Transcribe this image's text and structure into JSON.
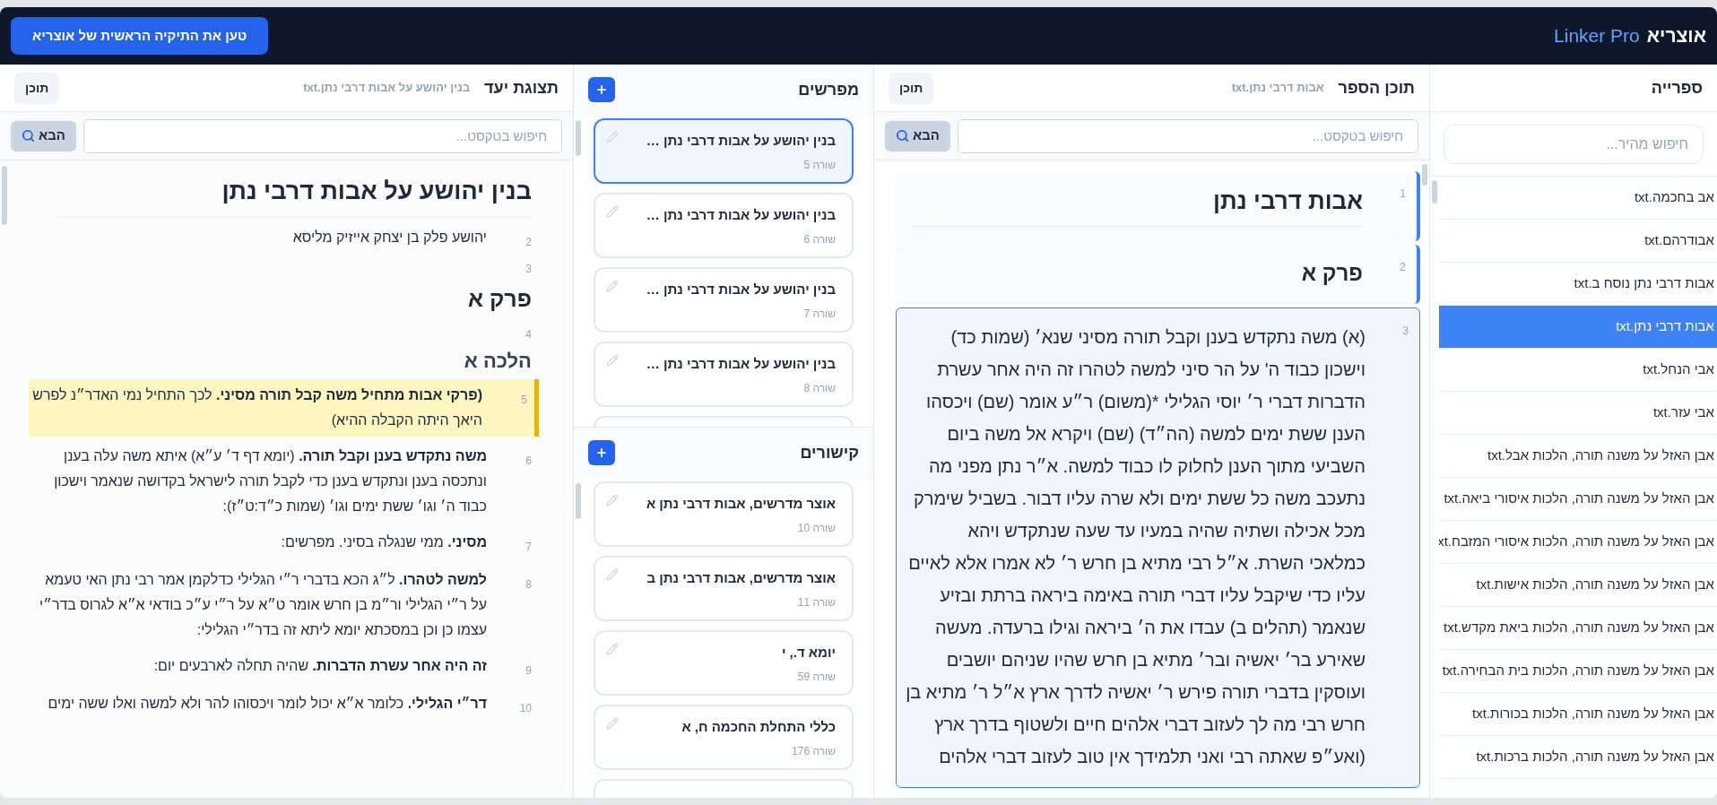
{
  "header": {
    "brand": "אוצריא",
    "product": "Linker Pro",
    "load_button": "טען את התיקיה הראשית של אוצריא"
  },
  "library": {
    "title": "ספרייה",
    "search": {
      "placeholder": "חיפוש מהיר..."
    },
    "items": [
      {
        "label": "אב בחכמה.txt",
        "selected": false
      },
      {
        "label": "אבודרהם.txt",
        "selected": false
      },
      {
        "label": "אבות דרבי נתן נוסח ב.txt",
        "selected": false
      },
      {
        "label": "אבות דרבי נתן.txt",
        "selected": true
      },
      {
        "label": "אבי הנחל.txt",
        "selected": false
      },
      {
        "label": "אבי עזר.txt",
        "selected": false
      },
      {
        "label": "אבן האזל על משנה תורה, הלכות אבל.txt",
        "selected": false
      },
      {
        "label": "אבן האזל על משנה תורה, הלכות איסורי ביאה.txt",
        "selected": false
      },
      {
        "label": "אבן האזל על משנה תורה, הלכות איסורי המזבח.xt",
        "selected": false
      },
      {
        "label": "אבן האזל על משנה תורה, הלכות אישות.txt",
        "selected": false
      },
      {
        "label": "אבן האזל על משנה תורה, הלכות ביאת מקדש.txt",
        "selected": false
      },
      {
        "label": "אבן האזל על משנה תורה, הלכות בית הבחירה.txt",
        "selected": false
      },
      {
        "label": "אבן האזל על משנה תורה, הלכות בכורות.txt",
        "selected": false
      },
      {
        "label": "אבן האזל על משנה תורה, הלכות ברכות.txt",
        "selected": false
      }
    ]
  },
  "book": {
    "title": "תוכן הספר",
    "file": "אבות דרבי נתן.txt",
    "toc_button": "תוכן",
    "search": {
      "placeholder": "חיפוש בטקסט...",
      "button": "הבא"
    },
    "lines": [
      {
        "number": "1",
        "kind": "title",
        "text": "אבות דרבי נתן",
        "selected": false,
        "linked": true
      },
      {
        "number": "2",
        "kind": "heading",
        "text": "פרק א",
        "selected": false,
        "linked": true
      },
      {
        "number": "3",
        "kind": "text",
        "selected": true,
        "linked": false,
        "lines": [
          "(א) משה נתקדש בענן וקבל תורה מסיני שנא׳ (שמות כד)",
          "וישכון כבוד ה' על הר סיני למשה לטהרו זה היה אחר עשרת",
          "הדברות דברי ר׳ יוסי הגלילי *(משום) ר״ע אומר (שם) ויכסהו",
          "הענן ששת ימים למשה (הה״ד) (שם) ויקרא אל משה ביום",
          "השביעי מתוך הענן לחלוק לו כבוד למשה. א״ר נתן מפני מה",
          "נתעכב משה כל ששת ימים ולא שרה עליו דבור. בשביל שימרק",
          "מכל אכילה ושתיה שהיה במעיו עד שעה שנתקדש ויהא",
          "כמלאכי השרת. א״ל רבי מתיא בן חרש ר׳ לא אמרו אלא לאיים",
          "עליו כדי שיקבל עליו דברי תורה באימה ביראה ברתת ובזיע",
          "שנאמר (תהלים ב) עבדו את ה׳ ביראה וגילו ברעדה. מעשה",
          "שאירע בר׳ יאשיה ובר׳ מתיא בן חרש שהיו שניהם יושבים",
          "ועוסקין בדברי תורה פירש ר׳ יאשיה לדרך ארץ א״ל ר׳ מתיא בן",
          "חרש רבי מה לך לעזוב דברי אלהים חיים ולשטוף בדרך ארץ",
          "(ואע״פ שאתה רבי ואני תלמידך אין טוב לעזוב דברי אלהים"
        ]
      }
    ]
  },
  "commentaries": {
    "title": "מפרשים",
    "items": [
      {
        "title": "בנין יהושע על אבות דרבי נתן …",
        "line": "שורה 5",
        "selected": true
      },
      {
        "title": "בנין יהושע על אבות דרבי נתן …",
        "line": "שורה 6",
        "selected": false
      },
      {
        "title": "בנין יהושע על אבות דרבי נתן …",
        "line": "שורה 7",
        "selected": false
      },
      {
        "title": "בנין יהושע על אבות דרבי נתן …",
        "line": "שורה 8",
        "selected": false
      }
    ]
  },
  "links": {
    "title": "קישורים",
    "items": [
      {
        "title": "אוצר מדרשים, אבות דרבי נתן א",
        "line": "שורה 10",
        "selected": false
      },
      {
        "title": "אוצר מדרשים, אבות דרבי נתן ב",
        "line": "שורה 11",
        "selected": false
      },
      {
        "title": "יומא ד., י",
        "line": "שורה 59",
        "selected": false
      },
      {
        "title": "כללי התחלת החכמה ח, א",
        "line": "שורה 176",
        "selected": false
      }
    ]
  },
  "target": {
    "title": "תצוגת יעד",
    "file": "בנין יהושע על אבות דרבי נתן.txt",
    "toc_button": "תוכן",
    "search": {
      "placeholder": "חיפוש בטקסט...",
      "button": "הבא"
    },
    "lines": [
      {
        "kind": "title",
        "text": "בנין יהושע על אבות דרבי נתן"
      },
      {
        "number": "2",
        "kind": "text",
        "text": "יהושע פלק בן יצחק אייזיק מליסא",
        "highlighted": false
      },
      {
        "number": "3",
        "kind": "heading",
        "text": "פרק א"
      },
      {
        "number": "4",
        "kind": "subheading",
        "text": "הלכה א"
      },
      {
        "number": "5",
        "kind": "text",
        "text": "**(פרקי אבות מתחיל משה קבל תורה מסיני.** לכך התחיל נמי האדר״נ לפרש היאך היתה הקבלה ההיא)",
        "highlighted": true
      },
      {
        "number": "6",
        "kind": "text",
        "text": "**משה נתקדש בענן וקבל תורה.** (יומא דף ד׳ ע״א) איתא משה עלה בענן ונתכסה בענן ונתקדש בענן כדי לקבל תורה לישראל בקדושה שנאמר וישכון כבוד ה׳ וגו׳ ששת ימים וגו׳ (שמות כ״ד:ט״ז):",
        "highlighted": false
      },
      {
        "number": "7",
        "kind": "text",
        "text": "**מסיני.** ממי שנגלה בסיני. מפרשים:",
        "highlighted": false
      },
      {
        "number": "8",
        "kind": "text",
        "text": "**למשה לטהרו.** ל״ג הכא בדברי ר״י הגלילי כדלקמן אמר רבי נתן האי טעמא על ר״י הגלילי ור״מ בן חרש אומר ט״א על ר״י ע״כ בודאי א״א לגרוס בדר״י עצמו כן וכן במסכתא יומא ליתא זה בדר״י הגלילי:",
        "highlighted": false
      },
      {
        "number": "9",
        "kind": "text",
        "text": "**זה היה אחר עשרת הדברות.** שהיה תחלה לארבעים יום:",
        "highlighted": false
      },
      {
        "number": "10",
        "kind": "text",
        "text": "**דר״י הגלילי.** כלומר א״א יכול לומר ויכסוהו להר ולא למשה ואלו ששה ימים",
        "highlighted": false
      }
    ]
  }
}
